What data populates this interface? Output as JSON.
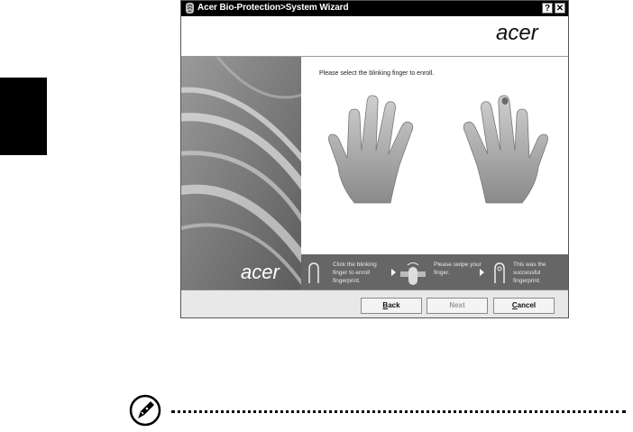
{
  "window": {
    "title": "Acer Bio-Protection>System Wizard",
    "help_button": "?",
    "close_button": "✕",
    "logo_text": "acer"
  },
  "wizard": {
    "instruction": "Please select the blinking finger to enroll.",
    "side_logo_text": "acer",
    "steps": [
      {
        "label": "Click the blinking finger to enroll fingerprint."
      },
      {
        "label": "Please swipe your finger."
      },
      {
        "label": "This was the successful fingerprint."
      }
    ]
  },
  "buttons": {
    "back_prefix": "",
    "back_key": "B",
    "back_rest": "ack",
    "next": "Next",
    "cancel_key": "C",
    "cancel_rest": "ancel"
  },
  "icons": {
    "title_icon": "fingerprint-shield-icon",
    "note_icon": "note-pen-icon"
  },
  "colors": {
    "titlebar": "#000000",
    "steps_bar": "#666666",
    "button_bar": "#e8e8e8"
  }
}
